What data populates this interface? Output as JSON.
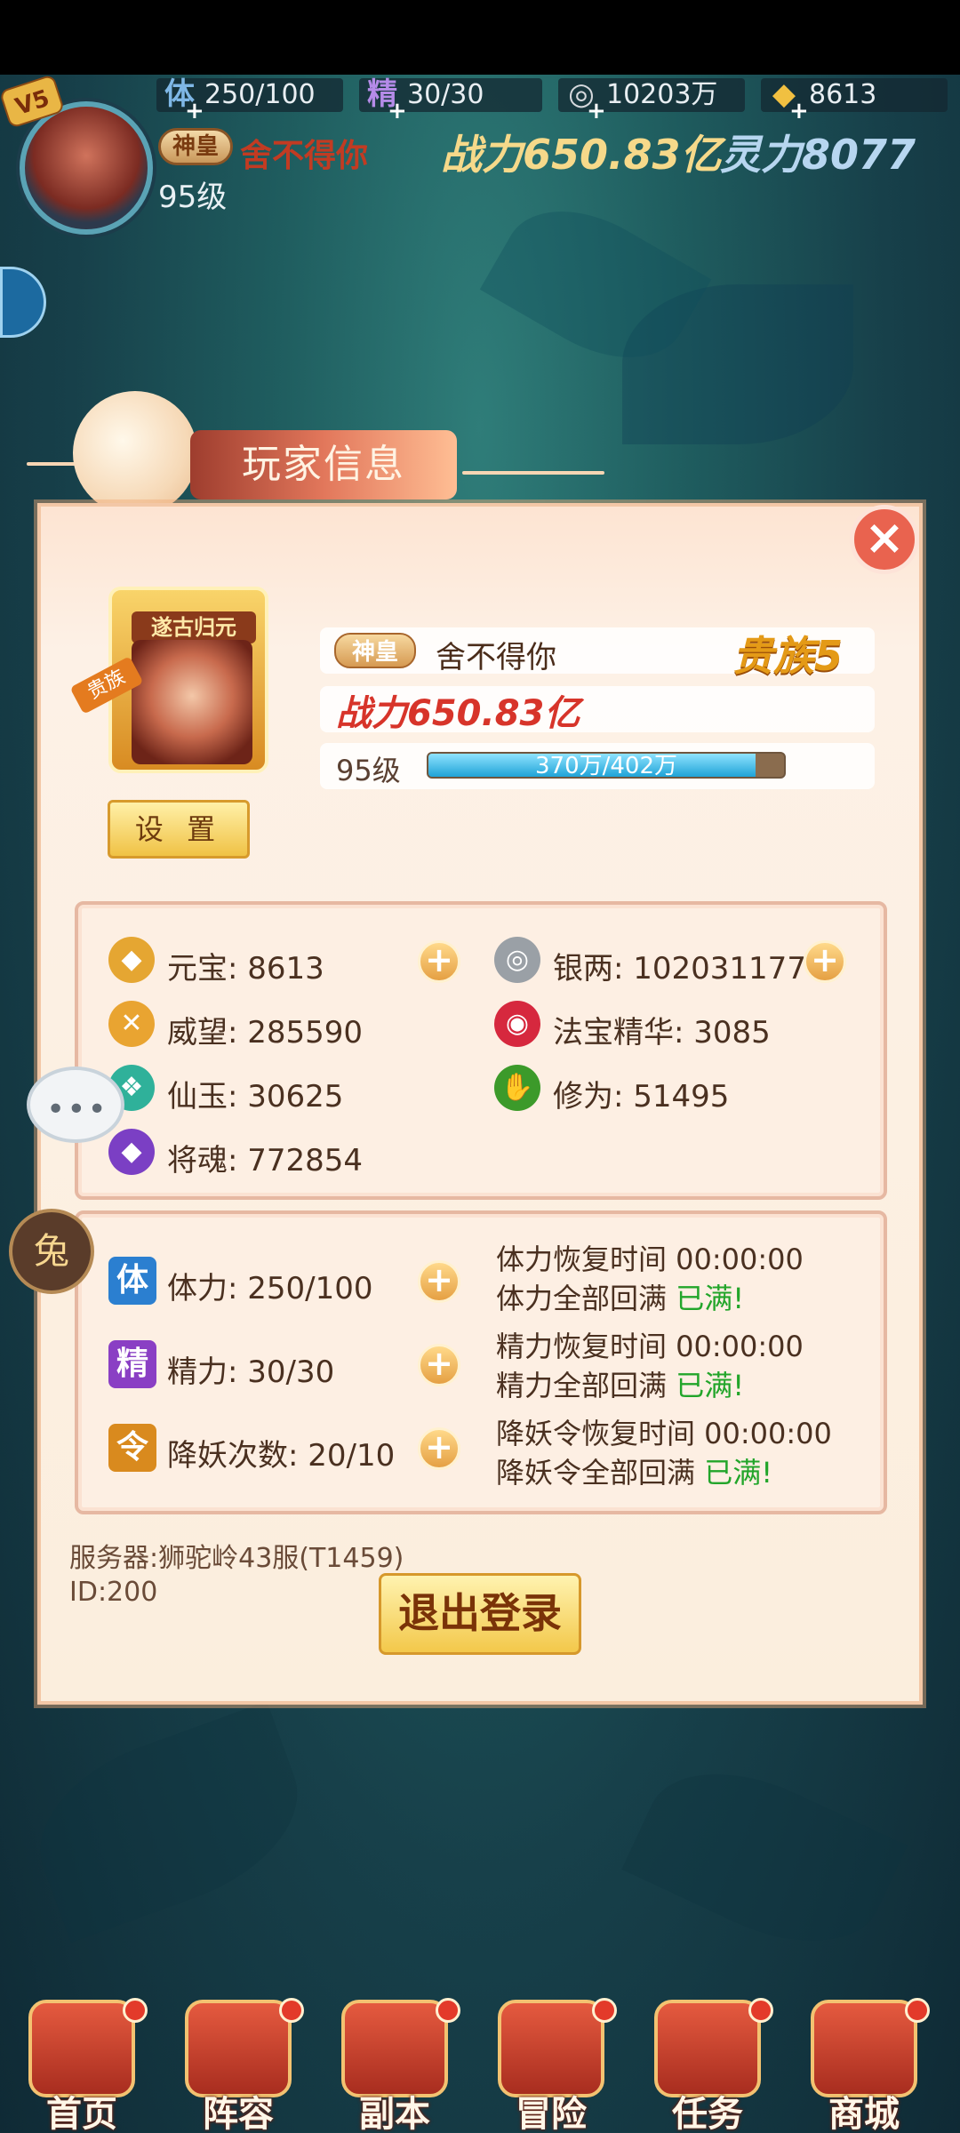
{
  "hud": {
    "vip": "5",
    "resources": [
      {
        "icon": "stamina-icon",
        "glyph": "体",
        "value": "250/100"
      },
      {
        "icon": "energy-icon",
        "glyph": "精",
        "value": "30/30"
      },
      {
        "icon": "silver-icon",
        "glyph": "◎",
        "value": "10203万"
      },
      {
        "icon": "ingot-icon",
        "glyph": "◆",
        "value": "8613"
      }
    ],
    "title_badge": "神皇",
    "name": "舍不得你",
    "power": "战力650.83亿",
    "spirit": "灵力8077",
    "level": "95级"
  },
  "panel": {
    "title": "玩家信息",
    "close": "×",
    "portrait_ribbon": "遂古归元",
    "portrait_tag": "贵族",
    "settings_label": "设 置",
    "title_badge": "神皇",
    "name": "舍不得你",
    "noble": "贵族5",
    "power": "战力650.83亿",
    "level": "95级",
    "xp_label": "370万/402万",
    "xp_ratio": 0.92,
    "resources": [
      {
        "icon": "ingot-icon",
        "glyph": "◆",
        "text": "元宝: 8613",
        "color": "#e5a632",
        "plus": true
      },
      {
        "icon": "silver-coin-icon",
        "glyph": "◎",
        "text": "银两: 102031177",
        "color": "#9aa0a6",
        "plus": true
      },
      {
        "icon": "prestige-icon",
        "glyph": "✕",
        "text": "威望: 285590",
        "color": "#e9a431",
        "plus": false
      },
      {
        "icon": "magic-essence-icon",
        "glyph": "◉",
        "text": "法宝精华: 3085",
        "color": "#d6283e",
        "plus": false
      },
      {
        "icon": "jade-icon",
        "glyph": "❖",
        "text": "仙玉: 30625",
        "color": "#2fb19a",
        "plus": false
      },
      {
        "icon": "cultivation-icon",
        "glyph": "✋",
        "text": "修为: 51495",
        "color": "#3c9a2a",
        "plus": false
      },
      {
        "icon": "general-soul-icon",
        "glyph": "◆",
        "text": "将魂: 772854",
        "color": "#7b3fc4",
        "plus": false
      }
    ],
    "stats": [
      {
        "icon": "stamina-icon",
        "glyph": "体",
        "color": "#2b7fd0",
        "text": "体力: 250/100",
        "rec_time": "体力恢复时间 00:00:00",
        "rec_full_label": "体力全部回满",
        "rec_full_status": "已满!"
      },
      {
        "icon": "energy-icon",
        "glyph": "精",
        "color": "#8a3fc4",
        "text": "精力: 30/30",
        "rec_time": "精力恢复时间 00:00:00",
        "rec_full_label": "精力全部回满",
        "rec_full_status": "已满!"
      },
      {
        "icon": "demon-token-icon",
        "glyph": "令",
        "color": "#d98a1e",
        "text": "降妖次数: 20/10",
        "rec_time": "降妖令恢复时间 00:00:00",
        "rec_full_label": "降妖令全部回满",
        "rec_full_status": "已满!"
      }
    ],
    "server": "服务器:狮驼岭43服(T1459)",
    "id": "ID:200",
    "logout": "退出登录"
  },
  "nav": [
    {
      "label": "首页",
      "icon": "home-icon"
    },
    {
      "label": "阵容",
      "icon": "lineup-icon"
    },
    {
      "label": "副本",
      "icon": "dungeon-icon"
    },
    {
      "label": "冒险",
      "icon": "adventure-icon"
    },
    {
      "label": "任务",
      "icon": "quest-icon"
    },
    {
      "label": "商城",
      "icon": "shop-icon"
    }
  ]
}
